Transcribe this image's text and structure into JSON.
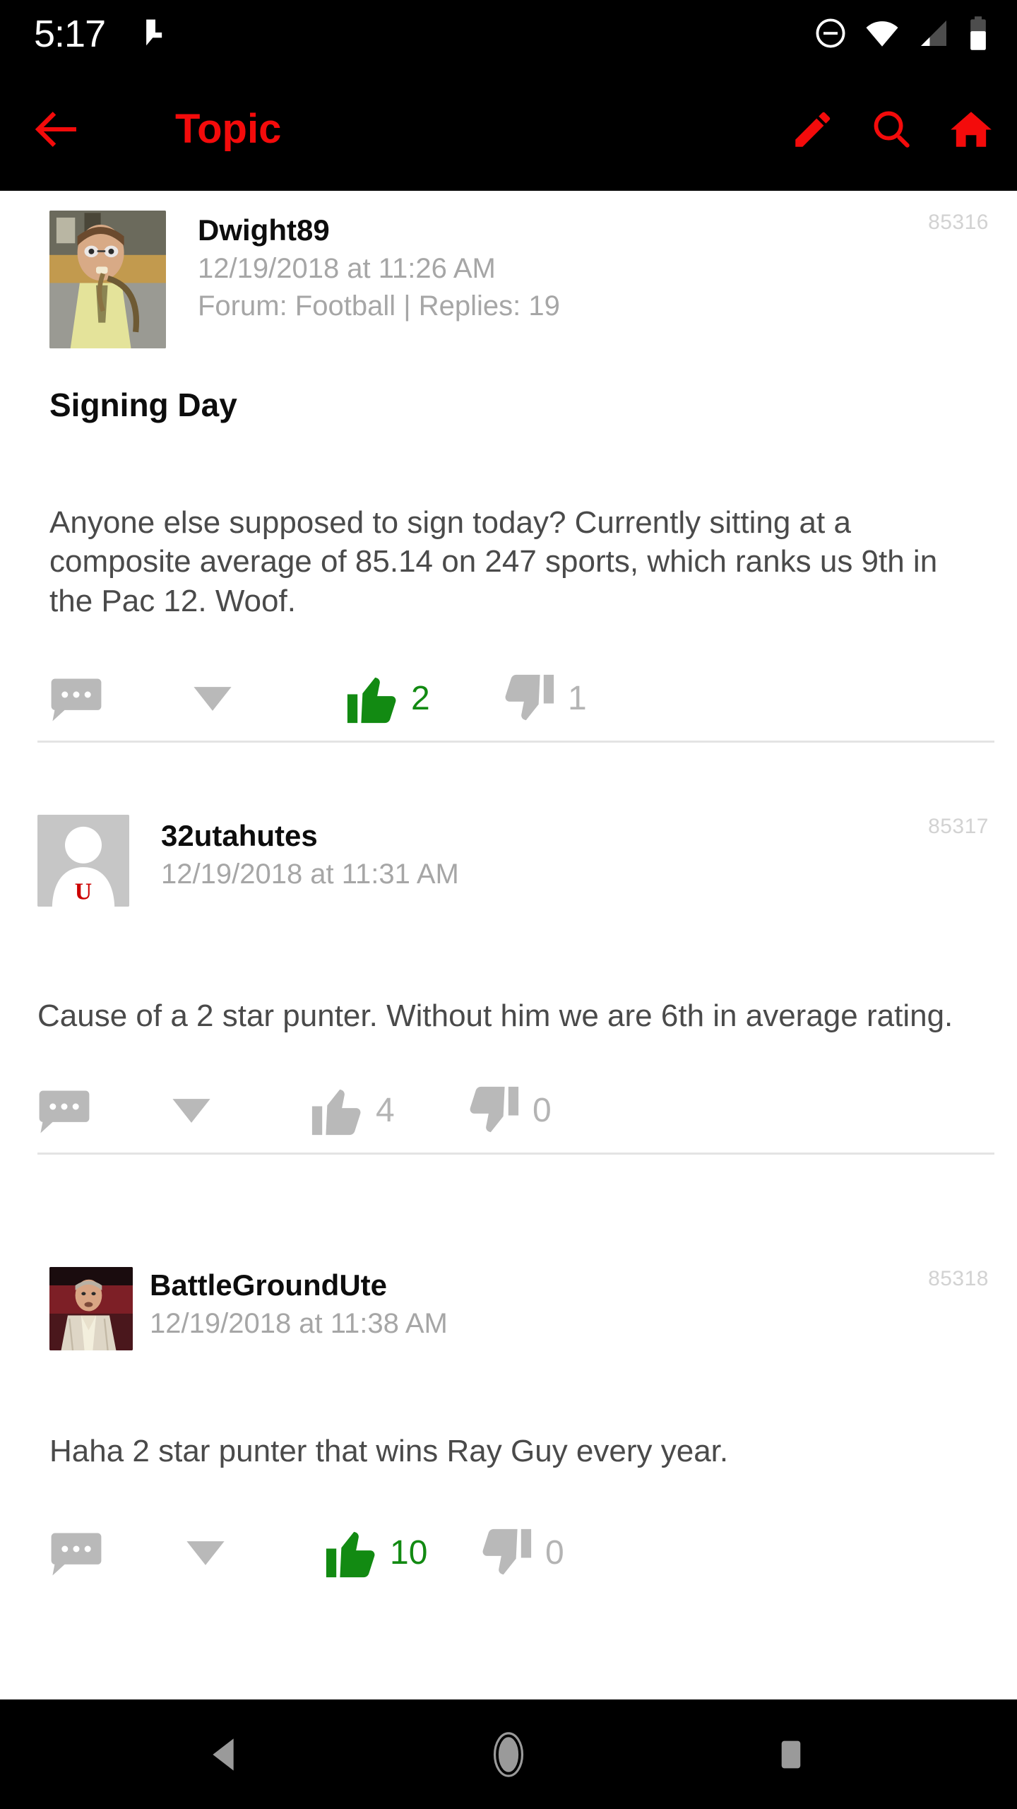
{
  "status_bar": {
    "time": "5:17",
    "icons": [
      "cast-icon",
      "do-not-disturb-icon",
      "wifi-icon",
      "cellular-signal-icon",
      "battery-icon"
    ]
  },
  "app_bar": {
    "back_label": "back-arrow-icon",
    "title": "Topic",
    "accent_color": "#f40b0b",
    "actions": [
      "compose-icon",
      "search-icon",
      "home-icon"
    ]
  },
  "colors": {
    "accent": "#f40b0b",
    "vote_active": "#128a12",
    "vote_inactive": "#b4b4b4",
    "meta_text": "#a6a6a6",
    "body_text": "#4a4a4a",
    "post_id": "#d2d2d2",
    "divider": "#e4e4e4"
  },
  "posts": [
    {
      "username": "Dwight89",
      "timestamp": "12/19/2018 at 11:26 AM",
      "forum_line": "Forum: Football | Replies: 19",
      "post_id": "85316",
      "thread_title": "Signing Day",
      "body": "Anyone else supposed to sign today? Currently sitting at a composite average of 85.14 on 247 sports, which ranks us 9th in the Pac 12. Woof.",
      "upvotes": "2",
      "downvotes": "1",
      "upvoted": true,
      "downvoted": false,
      "avatar_type": "photo-man-glasses"
    },
    {
      "username": "32utahutes",
      "timestamp": "12/19/2018 at 11:31 AM",
      "forum_line": "",
      "post_id": "85317",
      "thread_title": "",
      "body": "Cause of a 2 star punter. Without him we are 6th in average rating.",
      "upvotes": "4",
      "downvotes": "0",
      "upvoted": false,
      "downvoted": false,
      "avatar_type": "placeholder-person-u-badge"
    },
    {
      "username": "BattleGroundUte",
      "timestamp": "12/19/2018 at 11:38 AM",
      "forum_line": "",
      "post_id": "85318",
      "thread_title": "",
      "body": "Haha 2 star punter that wins Ray Guy every year.",
      "upvotes": "10",
      "downvotes": "0",
      "upvoted": true,
      "downvoted": false,
      "avatar_type": "photo-man-blazer"
    }
  ],
  "nav_bar": {
    "buttons": [
      "back-triangle-icon",
      "home-circle-icon",
      "recents-square-icon"
    ]
  }
}
